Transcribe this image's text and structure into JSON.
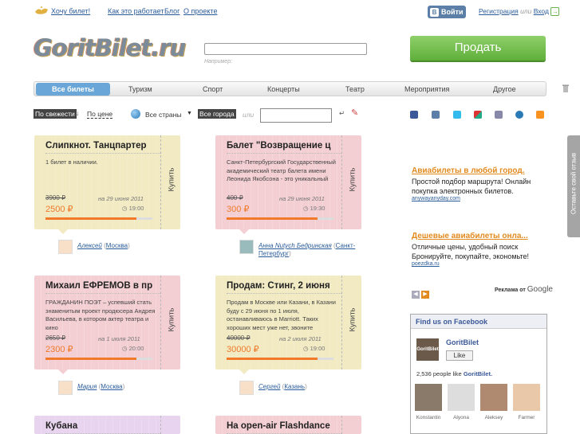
{
  "topbar": {
    "want_ticket": "Хочу билет!",
    "how_it_works": "Как это работает",
    "blog": "Блог",
    "about": "О проекте",
    "vk_login": "Войти",
    "register": "Регистрация",
    "or": "или",
    "login": "Вход"
  },
  "header": {
    "logo": "GoritBilet.ru",
    "search_hint": "Например:",
    "sell": "Продать"
  },
  "nav": {
    "items": [
      "Все билеты",
      "Туризм",
      "Спорт",
      "Концерты",
      "Театр",
      "Мероприятия",
      "Другое"
    ]
  },
  "filters": {
    "by_freshness": "По свежести",
    "by_price": "По цене",
    "all_countries": "Все страны",
    "all_cities": "Все города",
    "or": "или"
  },
  "cards": [
    {
      "title": "Слипкнот. Танцпартер",
      "desc": "1 билет в наличии.",
      "old_price": "3900 ₽",
      "new_price": "2500 ₽",
      "date": "на 29 июня 2011",
      "time": "19:00",
      "progress": 0.85,
      "buy": "Купить",
      "seller": "Алексей",
      "city": "Москва",
      "color": "#f1eac3"
    },
    {
      "title": "Балет \"Возвращение ц",
      "desc": "Санкт-Петербургский Государственный академический театр балета имени Леонида Якобсона - это уникальный",
      "old_price": "400 ₽",
      "new_price": "300 ₽",
      "date": "на 29 июня 2011",
      "time": "19:30",
      "progress": 0.85,
      "buy": "Купить",
      "seller": "Анна Nutych Бедринская",
      "city": "Санкт-Петербург",
      "color": "#f3cfd3"
    },
    {
      "title": "Михаил ЕФРЕМОВ в пр",
      "desc": "ГРАЖДАНИН ПОЭТ – успевший стать знаменитым проект продюсера Андрея Васильева, в котором актер театра и кино",
      "old_price": "2650 ₽",
      "new_price": "2300 ₽",
      "date": "на 1 июля 2011",
      "time": "20:00",
      "progress": 0.85,
      "buy": "Купить",
      "seller": "Мария",
      "city": "Москва",
      "color": "#f3cfd3"
    },
    {
      "title": "Продам: Стинг, 2 июня",
      "desc": "Продам в Москве или Казани, в Казани буду с 29 июня по 1 июля, останавливаюсь в Marriott. Таких хороших мест уже нет, звоните",
      "old_price": "40000 ₽",
      "new_price": "30000 ₽",
      "date": "на 2 июля 2011",
      "time": "19:00",
      "progress": 0.85,
      "buy": "Купить",
      "seller": "Сергей",
      "city": "Казань",
      "color": "#f1eac3"
    },
    {
      "title": "Кубана",
      "color": "#e8d4ee"
    },
    {
      "title": "На open-air Flashdance",
      "color": "#f3cfd3"
    }
  ],
  "ads": [
    {
      "heading": "Авиабилеты в любой город.",
      "text": "Простой подбор маршрута! Онлайн покупка электронных билетов.",
      "url": "anywayanyday.com"
    },
    {
      "heading": "Дешевые авиабилеты онла...",
      "text": "Отличные цены, удобный поиск Бронируйте, покупайте, экономьте!",
      "url": "poezdka.ru"
    }
  ],
  "ads_by": "Реклама от",
  "ads_by_brand": "Google",
  "facebook": {
    "heading": "Find us on Facebook",
    "page_name": "GoritBilet",
    "like": "Like",
    "count_text": "2,536 people like",
    "count_name": "GoritBilet.",
    "fans": [
      "Konstantin",
      "Alyona",
      "Aleksey",
      "Farmer"
    ]
  },
  "feedback": "Оставьте свой отзыв",
  "colors": {
    "accent_orange": "#f07a2a",
    "nav_active": "#6aa7d8",
    "sell_green": "#6ab04c",
    "link_blue": "#2a5c9a"
  }
}
